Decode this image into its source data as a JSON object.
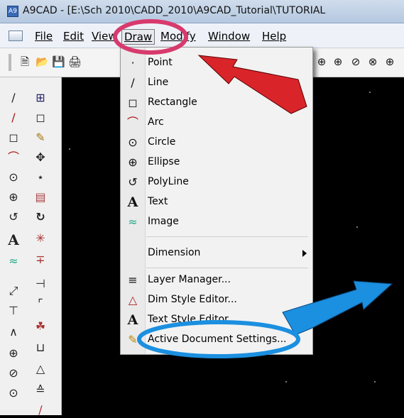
{
  "window": {
    "title": "A9CAD - [E:\\Sch          2010\\CADD_2010\\A9CAD_Tutorial\\TUTORIAL",
    "app_icon_text": "A9"
  },
  "menubar": {
    "items": [
      {
        "label": "File"
      },
      {
        "label": "Edit"
      },
      {
        "label": "View"
      },
      {
        "label": "Draw"
      },
      {
        "label": "Modify"
      },
      {
        "label": "Window"
      },
      {
        "label": "Help"
      }
    ]
  },
  "toolbar": {
    "icons": [
      "new-icon",
      "open-icon",
      "save-icon",
      "print-icon",
      "zoom-window-icon",
      "zoom-in-icon",
      "zoom-realtime-icon",
      "zoom-previous-icon",
      "zoom-extents-icon"
    ]
  },
  "draw_menu": {
    "items": [
      {
        "label": "Point",
        "icon": "point-icon"
      },
      {
        "label": "Line",
        "icon": "line-icon"
      },
      {
        "label": "Rectangle",
        "icon": "rectangle-icon"
      },
      {
        "label": "Arc",
        "icon": "arc-icon"
      },
      {
        "label": "Circle",
        "icon": "circle-icon"
      },
      {
        "label": "Ellipse",
        "icon": "ellipse-icon"
      },
      {
        "label": "PolyLine",
        "icon": "polyline-icon"
      },
      {
        "label": "Text",
        "icon": "text-icon"
      },
      {
        "label": "Image",
        "icon": "image-icon"
      },
      {
        "label": "Dimension",
        "icon": "",
        "submenu": true
      },
      {
        "label": "Layer Manager...",
        "icon": "layer-manager-icon"
      },
      {
        "label": "Dim Style Editor...",
        "icon": "dim-style-icon"
      },
      {
        "label": "Text Style Editor...",
        "icon": "text-style-icon"
      },
      {
        "label": "Active Document Settings...",
        "icon": "document-settings-icon"
      }
    ]
  },
  "annotations": {
    "red_color": "#d9252a",
    "blue_color": "#1b8fe0",
    "pink_color": "#d83a6e"
  }
}
